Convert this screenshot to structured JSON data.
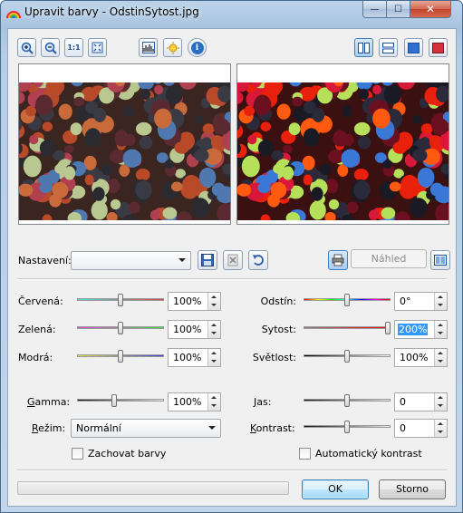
{
  "window": {
    "title": "Upravit barvy - OdstinSytost.jpg",
    "close_glyph": "✕",
    "minimize_glyph": "—",
    "maximize_glyph": "☐"
  },
  "toolbar": {
    "zoom_in": "zoom-in-icon",
    "zoom_out": "zoom-out-icon",
    "actual_size_label": "1:1",
    "fit_window": "fit-window-icon",
    "histogram": "histogram-icon",
    "effects": "effects-icon",
    "info_label": "i",
    "view_side_by_side": "side-by-side-icon",
    "view_split": "split-view-icon",
    "view_original": "original-view-icon",
    "view_result": "result-view-icon"
  },
  "settings": {
    "label": "Nastavení:",
    "value": "",
    "preview_button": "Náhled"
  },
  "left_controls": [
    {
      "label": "Červená:",
      "value": "100%",
      "pos": 0.5,
      "track": "linear-gradient(90deg,#40e0e0,#e04040)"
    },
    {
      "label": "Zelená:",
      "value": "100%",
      "pos": 0.5,
      "track": "linear-gradient(90deg,#e040e0,#40e040)"
    },
    {
      "label": "Modrá:",
      "value": "100%",
      "pos": 0.5,
      "track": "linear-gradient(90deg,#e0e040,#4040e0)"
    }
  ],
  "right_controls": [
    {
      "label": "Odstín:",
      "value": "0°",
      "pos": 0.5,
      "track": "linear-gradient(90deg,#ff0000,#ffff00,#00ff00,#00ffff,#0000ff,#ff00ff,#ff0000)"
    },
    {
      "label": "Sytost:",
      "value": "200%",
      "pos": 1.0,
      "track": "linear-gradient(90deg,#808080,#ff0000)"
    },
    {
      "label": "Světlost:",
      "value": "100%",
      "pos": 0.5,
      "track": "linear-gradient(90deg,#000000,#ffffff)"
    }
  ],
  "gamma": {
    "label": "Gamma:",
    "value": "100%",
    "pos": 0.42
  },
  "mode": {
    "label": "Režim:",
    "value": "Normální"
  },
  "brightness": {
    "label": "Jas:",
    "value": "0",
    "pos": 0.5
  },
  "contrast": {
    "label": "Kontrast:",
    "value": "0",
    "pos": 0.5
  },
  "keep_colors": "Zachovat barvy",
  "auto_contrast": "Automatický kontrast",
  "buttons": {
    "ok": "OK",
    "cancel": "Storno"
  }
}
